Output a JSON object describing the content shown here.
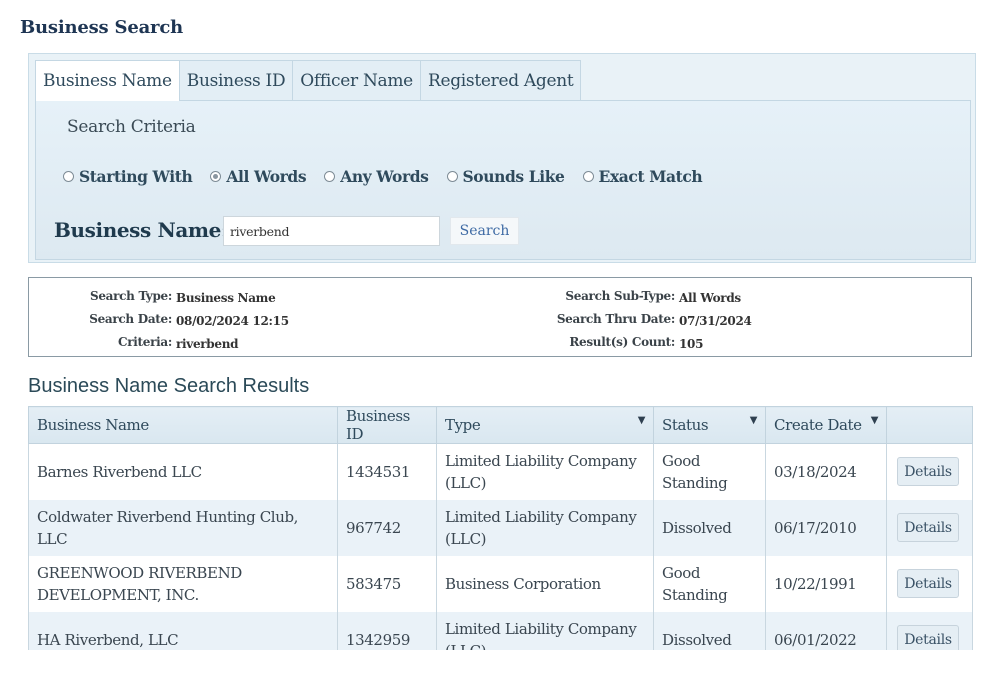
{
  "page": {
    "title": "Business Search"
  },
  "tabs": [
    {
      "label": "Business Name",
      "active": true
    },
    {
      "label": "Business ID",
      "active": false
    },
    {
      "label": "Officer Name",
      "active": false
    },
    {
      "label": "Registered Agent",
      "active": false
    }
  ],
  "criteria": {
    "title": "Search Criteria",
    "options": [
      {
        "label": "Starting With",
        "checked": false
      },
      {
        "label": "All Words",
        "checked": true
      },
      {
        "label": "Any Words",
        "checked": false
      },
      {
        "label": "Sounds Like",
        "checked": false
      },
      {
        "label": "Exact Match",
        "checked": false
      }
    ],
    "field_label": "Business Name:",
    "field_value": "riverbend",
    "search_button": "Search"
  },
  "summary": {
    "left": [
      {
        "label": "Search Type:",
        "value": "Business Name"
      },
      {
        "label": "Search Date:",
        "value": "08/02/2024 12:15"
      },
      {
        "label": "Criteria:",
        "value": "riverbend"
      }
    ],
    "right": [
      {
        "label": "Search Sub-Type:",
        "value": "All Words"
      },
      {
        "label": "Search Thru Date:",
        "value": "07/31/2024"
      },
      {
        "label": "Result(s) Count:",
        "value": "105"
      }
    ]
  },
  "results": {
    "title": "Business Name Search Results",
    "columns": [
      {
        "label": "Business Name",
        "filter": false
      },
      {
        "label": "Business ID",
        "filter": false
      },
      {
        "label": "Type",
        "filter": true
      },
      {
        "label": "Status",
        "filter": true
      },
      {
        "label": "Create Date",
        "filter": true
      },
      {
        "label": "",
        "filter": false
      }
    ],
    "filter_icon": "▼",
    "details_label": "Details",
    "rows": [
      {
        "name": "Barnes Riverbend LLC",
        "id": "1434531",
        "type": "Limited Liability Company (LLC)",
        "status": "Good Standing",
        "date": "03/18/2024"
      },
      {
        "name": "Coldwater Riverbend Hunting Club, LLC",
        "id": "967742",
        "type": "Limited Liability Company (LLC)",
        "status": "Dissolved",
        "date": "06/17/2010"
      },
      {
        "name": "GREENWOOD RIVERBEND DEVELOPMENT, INC.",
        "id": "583475",
        "type": "Business Corporation",
        "status": "Good Standing",
        "date": "10/22/1991"
      },
      {
        "name": "HA Riverbend, LLC",
        "id": "1342959",
        "type": "Limited Liability Company (LLC)",
        "status": "Dissolved",
        "date": "06/01/2022"
      }
    ]
  }
}
